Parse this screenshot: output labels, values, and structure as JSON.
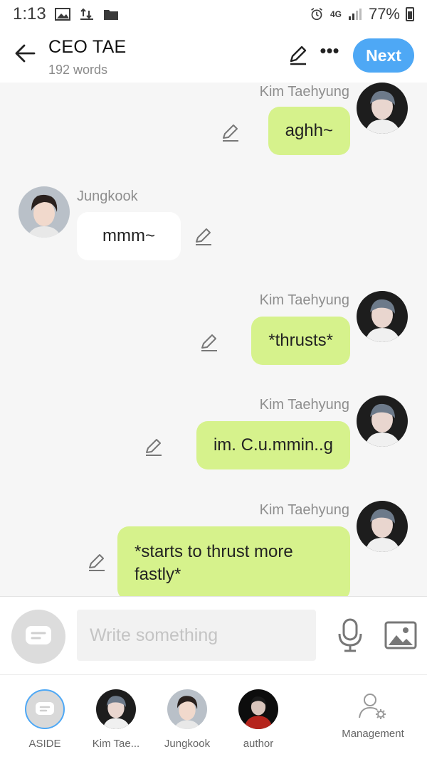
{
  "status_bar": {
    "time": "1:13",
    "network": "4G",
    "battery": "77%"
  },
  "header": {
    "title": "CEO TAE",
    "subtitle": "192 words",
    "next_label": "Next"
  },
  "messages": [
    {
      "sender": "Kim Taehyung",
      "text": "aghh~",
      "side": "right"
    },
    {
      "sender": "Jungkook",
      "text": "mmm~",
      "side": "left"
    },
    {
      "sender": "Kim Taehyung",
      "text": "*thrusts*",
      "side": "right"
    },
    {
      "sender": "Kim Taehyung",
      "text": "im. C.u.mmin..g",
      "side": "right"
    },
    {
      "sender": "Kim Taehyung",
      "line1": "*starts to thrust more",
      "line2": "fastly*",
      "side": "right"
    }
  ],
  "composer": {
    "placeholder": "Write something"
  },
  "bottom_bar": {
    "tabs": [
      {
        "label": "ASIDE"
      },
      {
        "label": "Kim Tae..."
      },
      {
        "label": "Jungkook"
      },
      {
        "label": "author"
      },
      {
        "label": "Management"
      }
    ]
  },
  "colors": {
    "accent": "#4ea8f5",
    "my_bubble": "#d6f28c",
    "their_bubble": "#ffffff"
  }
}
